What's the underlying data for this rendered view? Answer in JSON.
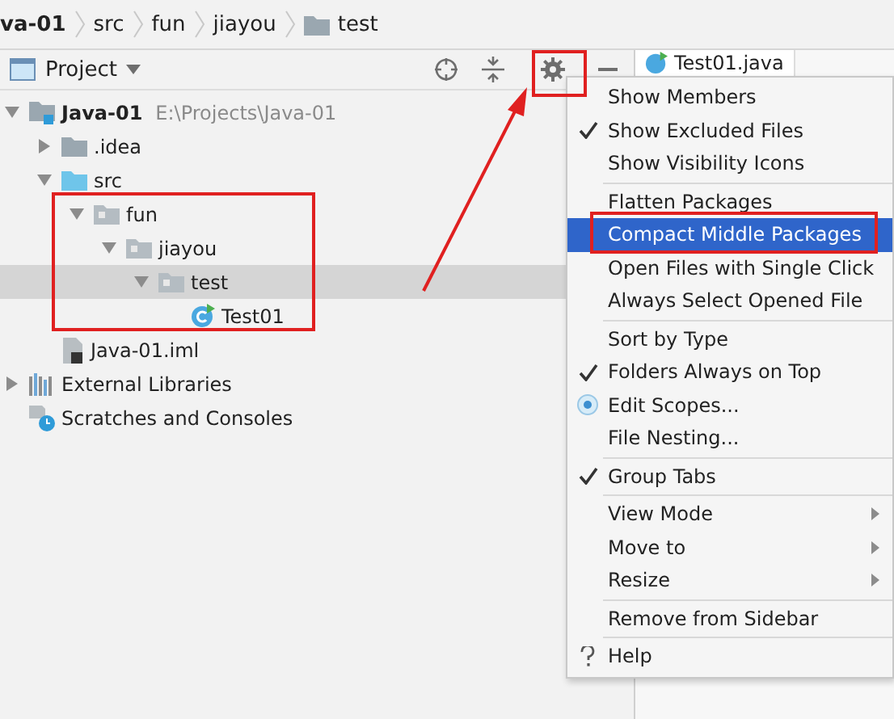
{
  "breadcrumb": [
    {
      "label": "va-01",
      "bold": true,
      "folder": false
    },
    {
      "label": "src",
      "bold": false,
      "folder": false
    },
    {
      "label": "fun",
      "bold": false,
      "folder": false
    },
    {
      "label": "jiayou",
      "bold": false,
      "folder": false
    },
    {
      "label": "test",
      "bold": false,
      "folder": true
    }
  ],
  "project_panel": {
    "title": "Project",
    "tree": [
      {
        "label": "Java-01",
        "hint": "E:\\Projects\\Java-01",
        "kind": "module",
        "expanded": true,
        "selected": false,
        "children": [
          {
            "label": ".idea",
            "kind": "folder",
            "expanded": false,
            "selected": false
          },
          {
            "label": "src",
            "kind": "source-folder",
            "expanded": true,
            "selected": false,
            "children": [
              {
                "label": "fun",
                "kind": "package",
                "expanded": true,
                "selected": false,
                "children": [
                  {
                    "label": "jiayou",
                    "kind": "package",
                    "expanded": true,
                    "selected": false,
                    "children": [
                      {
                        "label": "test",
                        "kind": "package",
                        "expanded": true,
                        "selected": true,
                        "children": [
                          {
                            "label": "Test01",
                            "kind": "class",
                            "selected": false
                          }
                        ]
                      }
                    ]
                  }
                ]
              }
            ]
          },
          {
            "label": "Java-01.iml",
            "kind": "iml",
            "selected": false
          }
        ]
      },
      {
        "label": "External Libraries",
        "kind": "libraries",
        "expanded": false,
        "selected": false
      },
      {
        "label": "Scratches and Consoles",
        "kind": "scratches",
        "selected": false
      }
    ]
  },
  "editor_tab": {
    "label": "Test01.java"
  },
  "menu": [
    {
      "kind": "plain",
      "label": "Show Members",
      "submenu": false,
      "selected": false
    },
    {
      "kind": "check",
      "label": "Show Excluded Files",
      "submenu": false,
      "selected": false
    },
    {
      "kind": "plain",
      "label": "Show Visibility Icons",
      "submenu": false,
      "selected": false
    },
    {
      "kind": "separator"
    },
    {
      "kind": "plain",
      "label": "Flatten Packages",
      "submenu": false,
      "selected": false
    },
    {
      "kind": "plain",
      "label": "Compact Middle Packages",
      "submenu": false,
      "selected": true
    },
    {
      "kind": "plain",
      "label": "Open Files with Single Click",
      "submenu": false,
      "selected": false
    },
    {
      "kind": "plain",
      "label": "Always Select Opened File",
      "submenu": false,
      "selected": false
    },
    {
      "kind": "separator"
    },
    {
      "kind": "plain",
      "label": "Sort by Type",
      "submenu": false,
      "selected": false
    },
    {
      "kind": "check",
      "label": "Folders Always on Top",
      "submenu": false,
      "selected": false
    },
    {
      "kind": "radio",
      "label": "Edit Scopes...",
      "submenu": false,
      "selected": false
    },
    {
      "kind": "plain",
      "label": "File Nesting...",
      "submenu": false,
      "selected": false
    },
    {
      "kind": "separator"
    },
    {
      "kind": "check",
      "label": "Group Tabs",
      "submenu": false,
      "selected": false
    },
    {
      "kind": "separator"
    },
    {
      "kind": "plain",
      "label": "View Mode",
      "submenu": true,
      "selected": false
    },
    {
      "kind": "plain",
      "label": "Move to",
      "submenu": true,
      "selected": false
    },
    {
      "kind": "plain",
      "label": "Resize",
      "submenu": true,
      "selected": false
    },
    {
      "kind": "separator"
    },
    {
      "kind": "plain",
      "label": "Remove from Sidebar",
      "submenu": false,
      "selected": false
    },
    {
      "kind": "separator"
    },
    {
      "kind": "help",
      "label": "Help",
      "submenu": false,
      "selected": false
    }
  ]
}
